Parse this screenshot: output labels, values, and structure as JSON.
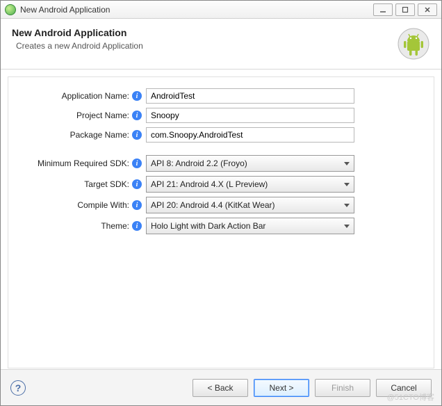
{
  "window": {
    "title": "New Android Application"
  },
  "banner": {
    "heading": "New Android Application",
    "subtitle": "Creates a new Android Application"
  },
  "fields": {
    "app_name": {
      "label": "Application Name:",
      "value": "AndroidTest"
    },
    "project_name": {
      "label": "Project Name:",
      "value": "Snoopy"
    },
    "package_name": {
      "label": "Package Name:",
      "value": "com.Snoopy.AndroidTest"
    },
    "min_sdk": {
      "label": "Minimum Required SDK:",
      "value": "API 8: Android 2.2 (Froyo)"
    },
    "target_sdk": {
      "label": "Target SDK:",
      "value": "API 21: Android 4.X (L Preview)"
    },
    "compile_with": {
      "label": "Compile With:",
      "value": "API 20: Android 4.4 (KitKat Wear)"
    },
    "theme": {
      "label": "Theme:",
      "value": "Holo Light with Dark Action Bar"
    }
  },
  "buttons": {
    "back": "< Back",
    "next": "Next >",
    "finish": "Finish",
    "cancel": "Cancel"
  },
  "watermark": "@51CTO博客"
}
